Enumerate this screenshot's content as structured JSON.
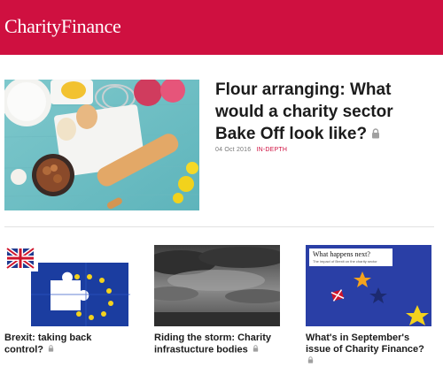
{
  "header": {
    "logo_text": "CharityFinance",
    "brand_color": "#cf1040"
  },
  "featured": {
    "title": "Flour arranging: What would a charity sector Bake Off look like?",
    "date": "04 Oct 2016",
    "tag": "IN-DEPTH",
    "locked": true,
    "image_icon": "baking-flatlay-image"
  },
  "cards": [
    {
      "title": "Brexit: taking back control?",
      "locked": true,
      "image_icon": "eu-uk-jigsaw-image"
    },
    {
      "title": "Riding the storm: Charity infrastucture bodies",
      "locked": true,
      "image_icon": "storm-clouds-image"
    },
    {
      "title": "What's in September's issue of Charity Finance?",
      "locked": true,
      "image_icon": "magazine-cover-image",
      "cover_heading": "What happens next?",
      "cover_sub": "The impact of Brexit on the charity sector"
    }
  ],
  "icons": {
    "lock": "lock-icon"
  }
}
